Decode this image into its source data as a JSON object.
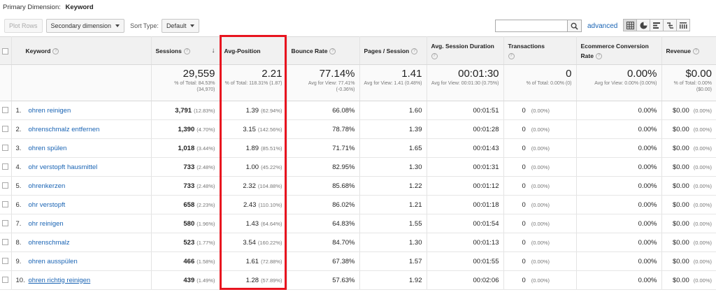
{
  "primary_dimension": {
    "label": "Primary Dimension:",
    "value": "Keyword"
  },
  "toolbar": {
    "plot_rows": "Plot Rows",
    "secondary_dimension": "Secondary dimension",
    "sort_type_label": "Sort Type:",
    "sort_type_value": "Default",
    "search_value": "",
    "advanced": "advanced"
  },
  "columns": {
    "keyword": "Keyword",
    "sessions": "Sessions",
    "avg_position": "Avg-Position",
    "bounce_rate": "Bounce Rate",
    "pages_session": "Pages / Session",
    "avg_session_duration": "Avg. Session Duration",
    "transactions": "Transactions",
    "ecommerce_conversion_rate": "Ecommerce Conversion Rate",
    "revenue": "Revenue"
  },
  "totals": {
    "sessions": "29,559",
    "sessions_sub": "% of Total: 84.53% (34,970)",
    "avg_position": "2.21",
    "avg_position_sub": "% of Total: 118.31% (1.87)",
    "bounce_rate": "77.14%",
    "bounce_rate_sub": "Avg for View: 77.41% (-0.36%)",
    "pages_session": "1.41",
    "pages_session_sub": "Avg for View: 1.41 (0.48%)",
    "avg_session_duration": "00:01:30",
    "avg_session_duration_sub": "Avg for View: 00:01:30 (0.75%)",
    "transactions": "0",
    "transactions_sub": "% of Total: 0.00% (0)",
    "ecommerce_conversion_rate": "0.00%",
    "ecommerce_conversion_rate_sub": "Avg for View: 0.00% (0.00%)",
    "revenue": "$0.00",
    "revenue_sub": "% of Total: 0.00% ($0.00)"
  },
  "rows": [
    {
      "idx": "1.",
      "keyword": "ohren reinigen",
      "sessions": "3,791",
      "sessions_pct": "(12.83%)",
      "avg_position": "1.39",
      "avg_position_pct": "(62.94%)",
      "bounce_rate": "66.08%",
      "pages_session": "1.60",
      "duration": "00:01:51",
      "transactions": "0",
      "transactions_pct": "(0.00%)",
      "conversion": "0.00%",
      "revenue": "$0.00",
      "revenue_pct": "(0.00%)"
    },
    {
      "idx": "2.",
      "keyword": "ohrenschmalz entfernen",
      "sessions": "1,390",
      "sessions_pct": "(4.70%)",
      "avg_position": "3.15",
      "avg_position_pct": "(142.56%)",
      "bounce_rate": "78.78%",
      "pages_session": "1.39",
      "duration": "00:01:28",
      "transactions": "0",
      "transactions_pct": "(0.00%)",
      "conversion": "0.00%",
      "revenue": "$0.00",
      "revenue_pct": "(0.00%)"
    },
    {
      "idx": "3.",
      "keyword": "ohren spülen",
      "sessions": "1,018",
      "sessions_pct": "(3.44%)",
      "avg_position": "1.89",
      "avg_position_pct": "(85.51%)",
      "bounce_rate": "71.71%",
      "pages_session": "1.65",
      "duration": "00:01:43",
      "transactions": "0",
      "transactions_pct": "(0.00%)",
      "conversion": "0.00%",
      "revenue": "$0.00",
      "revenue_pct": "(0.00%)"
    },
    {
      "idx": "4.",
      "keyword": "ohr verstopft hausmittel",
      "sessions": "733",
      "sessions_pct": "(2.48%)",
      "avg_position": "1.00",
      "avg_position_pct": "(45.22%)",
      "bounce_rate": "82.95%",
      "pages_session": "1.30",
      "duration": "00:01:31",
      "transactions": "0",
      "transactions_pct": "(0.00%)",
      "conversion": "0.00%",
      "revenue": "$0.00",
      "revenue_pct": "(0.00%)"
    },
    {
      "idx": "5.",
      "keyword": "ohrenkerzen",
      "sessions": "733",
      "sessions_pct": "(2.48%)",
      "avg_position": "2.32",
      "avg_position_pct": "(104.88%)",
      "bounce_rate": "85.68%",
      "pages_session": "1.22",
      "duration": "00:01:12",
      "transactions": "0",
      "transactions_pct": "(0.00%)",
      "conversion": "0.00%",
      "revenue": "$0.00",
      "revenue_pct": "(0.00%)"
    },
    {
      "idx": "6.",
      "keyword": "ohr verstopft",
      "sessions": "658",
      "sessions_pct": "(2.23%)",
      "avg_position": "2.43",
      "avg_position_pct": "(110.10%)",
      "bounce_rate": "86.02%",
      "pages_session": "1.21",
      "duration": "00:01:18",
      "transactions": "0",
      "transactions_pct": "(0.00%)",
      "conversion": "0.00%",
      "revenue": "$0.00",
      "revenue_pct": "(0.00%)"
    },
    {
      "idx": "7.",
      "keyword": "ohr reinigen",
      "sessions": "580",
      "sessions_pct": "(1.96%)",
      "avg_position": "1.43",
      "avg_position_pct": "(64.64%)",
      "bounce_rate": "64.83%",
      "pages_session": "1.55",
      "duration": "00:01:54",
      "transactions": "0",
      "transactions_pct": "(0.00%)",
      "conversion": "0.00%",
      "revenue": "$0.00",
      "revenue_pct": "(0.00%)"
    },
    {
      "idx": "8.",
      "keyword": "ohrenschmalz",
      "sessions": "523",
      "sessions_pct": "(1.77%)",
      "avg_position": "3.54",
      "avg_position_pct": "(160.22%)",
      "bounce_rate": "84.70%",
      "pages_session": "1.30",
      "duration": "00:01:13",
      "transactions": "0",
      "transactions_pct": "(0.00%)",
      "conversion": "0.00%",
      "revenue": "$0.00",
      "revenue_pct": "(0.00%)"
    },
    {
      "idx": "9.",
      "keyword": "ohren ausspülen",
      "sessions": "466",
      "sessions_pct": "(1.58%)",
      "avg_position": "1.61",
      "avg_position_pct": "(72.88%)",
      "bounce_rate": "67.38%",
      "pages_session": "1.57",
      "duration": "00:01:55",
      "transactions": "0",
      "transactions_pct": "(0.00%)",
      "conversion": "0.00%",
      "revenue": "$0.00",
      "revenue_pct": "(0.00%)"
    },
    {
      "idx": "10.",
      "keyword": "ohren richtig reinigen",
      "sessions": "439",
      "sessions_pct": "(1.49%)",
      "avg_position": "1.28",
      "avg_position_pct": "(57.89%)",
      "bounce_rate": "57.63%",
      "pages_session": "1.92",
      "duration": "00:02:06",
      "transactions": "0",
      "transactions_pct": "(0.00%)",
      "conversion": "0.00%",
      "revenue": "$0.00",
      "revenue_pct": "(0.00%)"
    }
  ],
  "icons": {
    "search": "search-icon",
    "sort": "sort-desc-icon",
    "help": "help-icon",
    "views": [
      "table-view-icon",
      "pie-view-icon",
      "performance-view-icon",
      "comparison-view-icon",
      "pivot-view-icon"
    ]
  },
  "colors": {
    "highlight": "#e8141f",
    "link": "#1a64b4"
  }
}
